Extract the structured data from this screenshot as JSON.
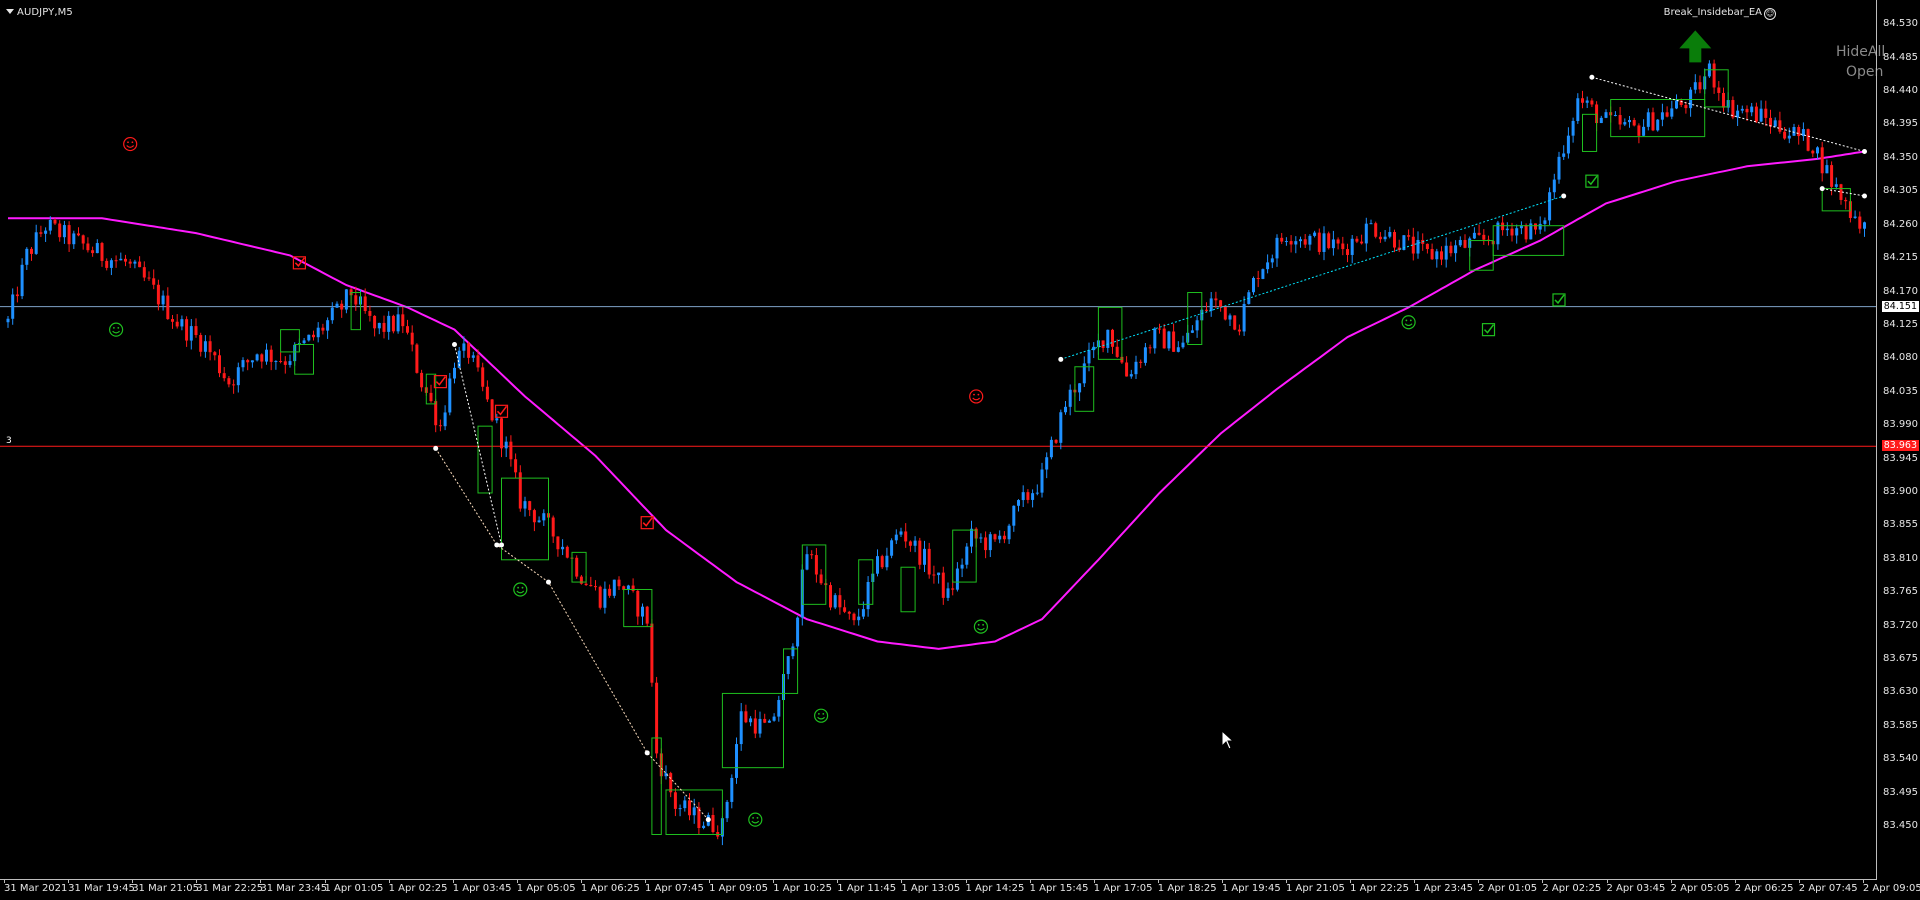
{
  "window": {
    "symbol": "AUDJPY,M5",
    "expert": "Break_Insidebar_EA",
    "expert_icon": "smiley-icon",
    "buttons": [
      "HideAll",
      "Open"
    ]
  },
  "colors": {
    "background": "#000000",
    "bull_candle": "#1e90ff",
    "bear_candle": "#ff1a1a",
    "moving_average": "#ff1aff",
    "inside_bar_box": "#1fbf1f",
    "horizontal_line": "#7fa3c8",
    "trade_line": "#ff1a1a",
    "signal_arrow": "#0a7d0a"
  },
  "price_scale": {
    "ticks": [
      "84.530",
      "84.485",
      "84.440",
      "84.395",
      "84.350",
      "84.305",
      "84.260",
      "84.215",
      "84.170",
      "84.125",
      "84.080",
      "84.035",
      "83.990",
      "83.945",
      "83.900",
      "83.855",
      "83.810",
      "83.765",
      "83.720",
      "83.675",
      "83.630",
      "83.585",
      "83.540",
      "83.495",
      "83.450"
    ],
    "tags": [
      {
        "label": "84.151",
        "style": "horizontal-line"
      },
      {
        "label": "83.963",
        "style": "trade-level"
      }
    ]
  },
  "time_scale": {
    "ticks": [
      "31 Mar 2021",
      "31 Mar 19:45",
      "31 Mar 21:05",
      "31 Mar 22:25",
      "31 Mar 23:45",
      "1 Apr 01:05",
      "1 Apr 02:25",
      "1 Apr 03:45",
      "1 Apr 05:05",
      "1 Apr 06:25",
      "1 Apr 07:45",
      "1 Apr 09:05",
      "1 Apr 10:25",
      "1 Apr 11:45",
      "1 Apr 13:05",
      "1 Apr 14:25",
      "1 Apr 15:45",
      "1 Apr 17:05",
      "1 Apr 18:25",
      "1 Apr 19:45",
      "1 Apr 21:05",
      "1 Apr 22:25",
      "1 Apr 23:45",
      "2 Apr 01:05",
      "2 Apr 02:25",
      "2 Apr 03:45",
      "2 Apr 05:05",
      "2 Apr 06:25",
      "2 Apr 07:45",
      "2 Apr 09:05"
    ]
  },
  "levels": {
    "horizontal_line": 84.151,
    "trade_level": 83.963,
    "trade_marker": "3"
  },
  "chart_data": {
    "type": "candlestick",
    "price_range": [
      83.43,
      84.54
    ],
    "close_anchors": [
      [
        0,
        84.13
      ],
      [
        4,
        84.22
      ],
      [
        8,
        84.26
      ],
      [
        14,
        84.24
      ],
      [
        20,
        84.22
      ],
      [
        25,
        84.21
      ],
      [
        30,
        84.18
      ],
      [
        36,
        84.13
      ],
      [
        42,
        84.1
      ],
      [
        47,
        84.05
      ],
      [
        53,
        84.09
      ],
      [
        59,
        84.08
      ],
      [
        65,
        84.11
      ],
      [
        71,
        84.15
      ],
      [
        73,
        84.17
      ],
      [
        78,
        84.12
      ],
      [
        84,
        84.13
      ],
      [
        88,
        84.05
      ],
      [
        92,
        83.99
      ],
      [
        95,
        84.08
      ],
      [
        98,
        84.09
      ],
      [
        102,
        84.02
      ],
      [
        106,
        83.96
      ],
      [
        109,
        83.89
      ],
      [
        114,
        83.86
      ],
      [
        118,
        83.83
      ],
      [
        122,
        83.79
      ],
      [
        126,
        83.76
      ],
      [
        130,
        83.78
      ],
      [
        136,
        83.73
      ],
      [
        138,
        83.55
      ],
      [
        142,
        83.48
      ],
      [
        147,
        83.46
      ],
      [
        152,
        83.45
      ],
      [
        156,
        83.6
      ],
      [
        162,
        83.58
      ],
      [
        166,
        83.67
      ],
      [
        170,
        83.82
      ],
      [
        175,
        83.76
      ],
      [
        180,
        83.72
      ],
      [
        185,
        83.8
      ],
      [
        190,
        83.85
      ],
      [
        195,
        83.81
      ],
      [
        200,
        83.76
      ],
      [
        205,
        83.84
      ],
      [
        210,
        83.83
      ],
      [
        215,
        83.88
      ],
      [
        220,
        83.92
      ],
      [
        225,
        84.02
      ],
      [
        230,
        84.08
      ],
      [
        234,
        84.12
      ],
      [
        238,
        84.06
      ],
      [
        244,
        84.11
      ],
      [
        250,
        84.1
      ],
      [
        256,
        84.16
      ],
      [
        262,
        84.13
      ],
      [
        266,
        84.2
      ],
      [
        272,
        84.25
      ],
      [
        278,
        84.24
      ],
      [
        284,
        84.23
      ],
      [
        290,
        84.26
      ],
      [
        296,
        84.24
      ],
      [
        302,
        84.22
      ],
      [
        308,
        84.23
      ],
      [
        314,
        84.24
      ],
      [
        320,
        84.26
      ],
      [
        326,
        84.25
      ],
      [
        330,
        84.35
      ],
      [
        334,
        84.43
      ],
      [
        340,
        84.4
      ],
      [
        346,
        84.39
      ],
      [
        352,
        84.41
      ],
      [
        358,
        84.43
      ],
      [
        362,
        84.47
      ],
      [
        366,
        84.42
      ],
      [
        372,
        84.41
      ],
      [
        378,
        84.39
      ],
      [
        384,
        84.37
      ],
      [
        388,
        84.32
      ],
      [
        392,
        84.28
      ],
      [
        395,
        84.26
      ]
    ],
    "moving_average_anchors": [
      [
        0,
        84.27
      ],
      [
        20,
        84.27
      ],
      [
        40,
        84.25
      ],
      [
        60,
        84.22
      ],
      [
        72,
        84.18
      ],
      [
        85,
        84.15
      ],
      [
        95,
        84.12
      ],
      [
        110,
        84.03
      ],
      [
        125,
        83.95
      ],
      [
        140,
        83.85
      ],
      [
        155,
        83.78
      ],
      [
        170,
        83.73
      ],
      [
        185,
        83.7
      ],
      [
        198,
        83.69
      ],
      [
        210,
        83.7
      ],
      [
        220,
        83.73
      ],
      [
        232,
        83.81
      ],
      [
        245,
        83.9
      ],
      [
        258,
        83.98
      ],
      [
        270,
        84.04
      ],
      [
        285,
        84.11
      ],
      [
        298,
        84.15
      ],
      [
        312,
        84.2
      ],
      [
        326,
        84.24
      ],
      [
        340,
        84.29
      ],
      [
        355,
        84.32
      ],
      [
        370,
        84.34
      ],
      [
        385,
        84.35
      ],
      [
        395,
        84.36
      ]
    ],
    "inside_bar_boxes": [
      [
        58,
        62,
        84.09,
        84.12
      ],
      [
        61,
        65,
        84.06,
        84.1
      ],
      [
        73,
        75,
        84.12,
        84.17
      ],
      [
        89,
        91,
        84.02,
        84.06
      ],
      [
        100,
        103,
        83.9,
        83.99
      ],
      [
        105,
        115,
        83.81,
        83.92
      ],
      [
        120,
        123,
        83.78,
        83.82
      ],
      [
        131,
        137,
        83.72,
        83.77
      ],
      [
        137,
        139,
        83.44,
        83.57
      ],
      [
        140,
        152,
        83.44,
        83.5
      ],
      [
        152,
        165,
        83.53,
        83.63
      ],
      [
        165,
        168,
        83.63,
        83.69
      ],
      [
        169,
        174,
        83.75,
        83.83
      ],
      [
        181,
        184,
        83.75,
        83.81
      ],
      [
        190,
        193,
        83.74,
        83.8
      ],
      [
        201,
        206,
        83.78,
        83.85
      ],
      [
        227,
        231,
        84.01,
        84.07
      ],
      [
        232,
        237,
        84.08,
        84.15
      ],
      [
        251,
        254,
        84.1,
        84.17
      ],
      [
        311,
        316,
        84.2,
        84.24
      ],
      [
        316,
        331,
        84.22,
        84.26
      ],
      [
        335,
        338,
        84.36,
        84.41
      ],
      [
        341,
        361,
        84.38,
        84.43
      ],
      [
        361,
        366,
        84.42,
        84.47
      ],
      [
        386,
        392,
        84.28,
        84.31
      ]
    ],
    "green_check_markers": [
      [
        337,
        84.32
      ],
      [
        330,
        84.16
      ],
      [
        315,
        84.12
      ]
    ],
    "red_check_markers": [
      [
        62,
        84.21
      ],
      [
        92,
        84.05
      ],
      [
        105,
        84.01
      ],
      [
        136,
        83.86
      ]
    ],
    "green_smiley_markers": [
      [
        23,
        84.12
      ],
      [
        109,
        83.77
      ],
      [
        159,
        83.46
      ],
      [
        173,
        83.6
      ],
      [
        207,
        83.72
      ],
      [
        298,
        84.13
      ]
    ],
    "red_smiley_markers": [
      [
        26,
        84.37
      ],
      [
        206,
        84.03
      ]
    ],
    "trendlines": [
      {
        "color": "#ffe0c0",
        "points": [
          [
            91,
            83.96
          ],
          [
            104,
            83.83
          ],
          [
            115,
            83.78
          ],
          [
            136,
            83.55
          ],
          [
            149,
            83.46
          ]
        ]
      },
      {
        "color": "#ffffff",
        "points": [
          [
            95,
            84.1
          ],
          [
            105,
            83.83
          ]
        ]
      },
      {
        "color": "#00e5ff",
        "points": [
          [
            224,
            84.08
          ],
          [
            331,
            84.3
          ]
        ]
      },
      {
        "color": "#ffffff",
        "points": [
          [
            337,
            84.46
          ],
          [
            395,
            84.36
          ]
        ]
      },
      {
        "color": "#ffffff",
        "points": [
          [
            386,
            84.31
          ],
          [
            395,
            84.3
          ]
        ]
      }
    ],
    "up_arrow": [
      359,
      84.48
    ]
  }
}
